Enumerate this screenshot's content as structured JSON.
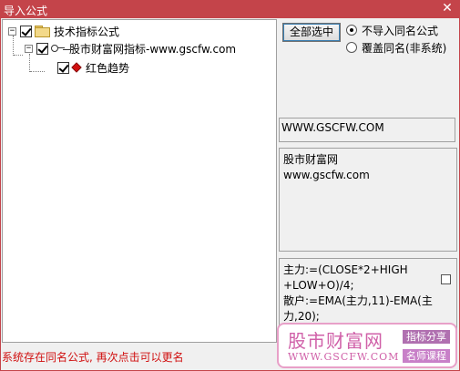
{
  "window": {
    "title": "导入公式",
    "close_glyph": "✕"
  },
  "tree": {
    "root": {
      "label": "技术指标公式",
      "toggle": "−"
    },
    "child": {
      "label": "股市财富网指标-www.gscfw.com",
      "toggle": "−"
    },
    "leaf": {
      "label": "红色趋势"
    }
  },
  "controls": {
    "select_all": "全部选中",
    "options": [
      {
        "label": "不导入同名公式",
        "selected": true
      },
      {
        "label": "覆盖同名(非系统)",
        "selected": false
      }
    ]
  },
  "info": {
    "url": "WWW.GSCFW.COM",
    "description_lines": [
      "股市财富网",
      "www.gscfw.com"
    ],
    "code_lines": [
      "主力:=(CLOSE*2+HIGH",
      "+LOW+O)/4;",
      "散户:=EMA(主力,11)-EMA(主",
      "力,20);"
    ]
  },
  "status": {
    "message": "系统存在同名公式, 再次点击可以更名"
  },
  "watermark": {
    "name": "股市财富网",
    "url": "WWW.GSCFW.COM",
    "tag1": "指标分享",
    "tag2": "名师课程"
  }
}
